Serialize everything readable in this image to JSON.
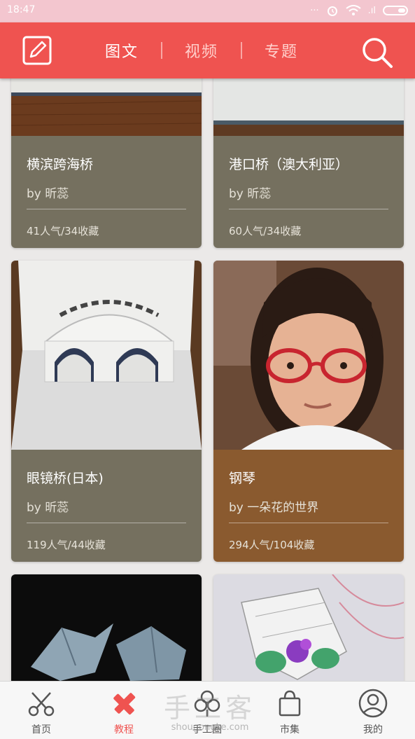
{
  "status": {
    "time": "18:47",
    "signal": ".ıl",
    "colors": {
      "bar": "#f3c6cf"
    }
  },
  "header": {
    "tabs": [
      {
        "label": "图文",
        "active": true
      },
      {
        "label": "视频",
        "active": false
      },
      {
        "label": "专题",
        "active": false
      }
    ],
    "icons": {
      "left": "edit-icon",
      "right": "search-icon"
    },
    "color": "#ef5350"
  },
  "cards": [
    {
      "title": "横滨跨海桥",
      "author": "by 昕蕊",
      "stats": "41人气/34收藏",
      "info_color": "#75705f"
    },
    {
      "title": "港口桥（澳大利亚）",
      "author": "by 昕蕊",
      "stats": "60人气/34收藏",
      "info_color": "#75705f"
    },
    {
      "title": "眼镜桥(日本)",
      "author": "by 昕蕊",
      "stats": "119人气/44收藏",
      "info_color": "#75705f"
    },
    {
      "title": "钢琴",
      "author": "by 一朵花的世界",
      "stats": "294人气/104收藏",
      "info_color": "#8a5a2f"
    },
    {
      "title": "",
      "author": "",
      "stats": ""
    },
    {
      "title": "",
      "author": "",
      "stats": ""
    }
  ],
  "bottom_nav": [
    {
      "label": "首页",
      "icon": "scissors-icon",
      "active": false
    },
    {
      "label": "教程",
      "icon": "pencil-ruler-icon",
      "active": true
    },
    {
      "label": "手工圈",
      "icon": "flower-icon",
      "active": false
    },
    {
      "label": "市集",
      "icon": "shopping-bag-icon",
      "active": false
    },
    {
      "label": "我的",
      "icon": "user-icon",
      "active": false
    }
  ],
  "watermark": {
    "brand": "手工客",
    "url": "shougongke.com"
  }
}
